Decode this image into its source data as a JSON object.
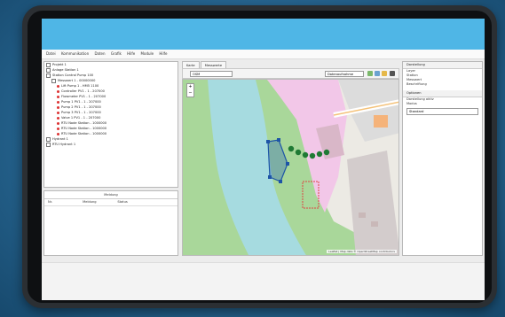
{
  "menu": [
    "Datei",
    "Kommunikation",
    "Daten",
    "Grafik",
    "Hilfe",
    "Module",
    "Hilfe"
  ],
  "tree": {
    "items": [
      {
        "label": "Projekt 1",
        "kind": "folder"
      },
      {
        "label": "Anlage Station 1",
        "kind": "folder"
      },
      {
        "label": "Station Control Pump 100",
        "kind": "folder"
      },
      {
        "label": "Messwert 1 - 00000000",
        "kind": "item"
      },
      {
        "label": "Lift Pump 1 - HM5 1100",
        "kind": "item"
      },
      {
        "label": "Controller PV1 - 1 - 207000",
        "kind": "item"
      },
      {
        "label": "Flowmeter PV1 - 1 - 207000",
        "kind": "item"
      },
      {
        "label": "Pump 1 PV1 - 1 - 207000",
        "kind": "item"
      },
      {
        "label": "Pump 2 PV1 - 1 - 207000",
        "kind": "item"
      },
      {
        "label": "Pump 3 PV1 - 1 - 207000",
        "kind": "item"
      },
      {
        "label": "Valve 1 PV1 - 1 - 207000",
        "kind": "item"
      },
      {
        "label": "RTU Node Station - 1000000",
        "kind": "item"
      },
      {
        "label": "RTU Node Station - 1000000",
        "kind": "item"
      },
      {
        "label": "RTU Node Station - 1000000",
        "kind": "item"
      },
      {
        "label": "Hydrant 1",
        "kind": "folder"
      },
      {
        "label": "RTU Hydrant 1",
        "kind": "folder"
      }
    ]
  },
  "log_panel": {
    "title": "Meldung",
    "columns": [
      "Nr.",
      "Meldung",
      "Status"
    ]
  },
  "tabs": [
    "Karte",
    "Messwerte"
  ],
  "map_toolbar": {
    "layer_select": "OSM",
    "mode_select": "Datenaufnahme"
  },
  "map": {
    "zoom_in": "+",
    "zoom_out": "−",
    "attribution": "Leaflet | Map data © OpenStreetMap contributors"
  },
  "right_panel": {
    "section1": "Darstellung",
    "items": [
      "Layer",
      "Station",
      "Messwert",
      "Beschriftung"
    ],
    "section2": "Optionen",
    "option": "Darstellung aktiv",
    "field_label": "Modus",
    "select_value": "Standard"
  },
  "colors": {
    "titlebar": "#4fb6e6",
    "river": "#a6dbe0",
    "park": "#a9d79a",
    "building_pink": "#f2c7e8",
    "marker_blue": "#1d54a6",
    "tree_green": "#1f7a34"
  }
}
